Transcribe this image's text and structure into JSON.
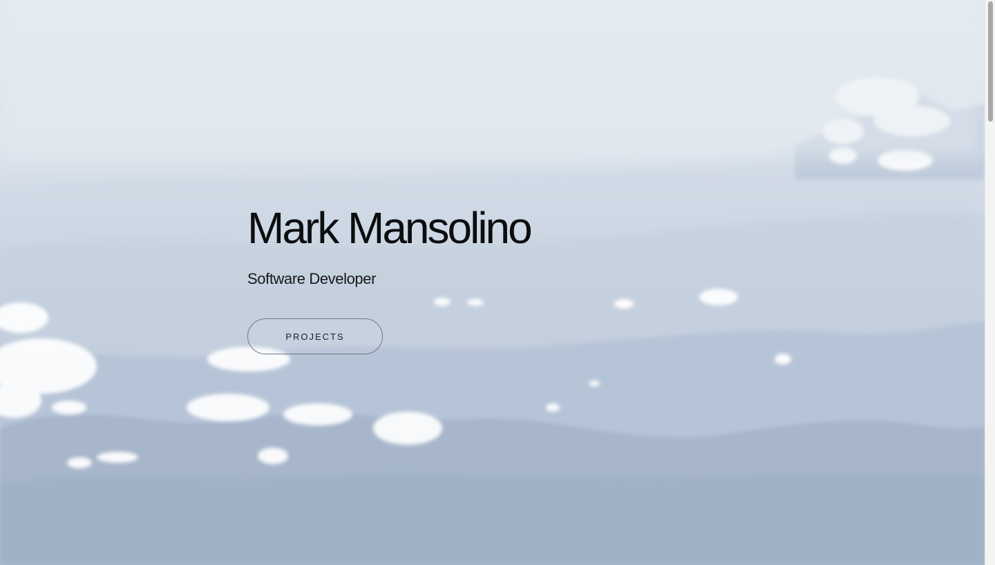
{
  "hero": {
    "name": "Mark Mansolino",
    "role": "Software Developer",
    "projects_button_label": "PROJECTS"
  },
  "background": {
    "description_icon": "mountains-clouds-image",
    "sky_color": "#e3e9f0",
    "mountain_color": "#a4b3c8"
  },
  "scrollbar": {
    "visible": true
  }
}
